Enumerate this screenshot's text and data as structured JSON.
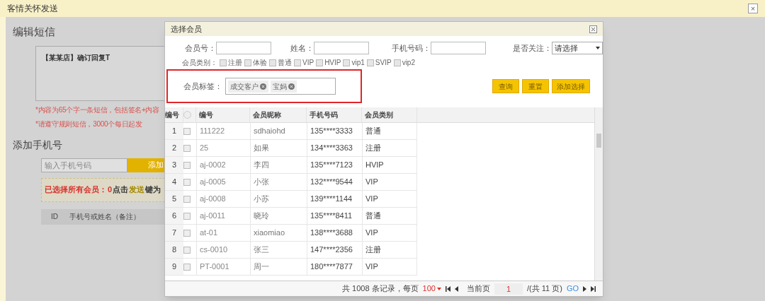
{
  "page": {
    "title": "客情关怀发送",
    "close": "×"
  },
  "editor": {
    "heading": "编辑短信",
    "message": "【某某店】确订回复T",
    "hints": [
      "*内容为65个字一条短信，包括签名+内容",
      "*请遵守规则短信，3000个每日起发"
    ]
  },
  "add_phone": {
    "heading": "添加手机号",
    "placeholder": "输入手机号码",
    "button": "添加",
    "notice_prefix": "已选择所有会员：",
    "count": "0",
    "notice_click": "点击",
    "notice_link": "发送",
    "notice_suffix": "键为"
  },
  "phone_table": {
    "columns": [
      "ID",
      "手机号或姓名（备注）"
    ]
  },
  "dialog": {
    "title": "选择会员",
    "filters": [
      {
        "kind": "input",
        "label": "会员号："
      },
      {
        "kind": "input",
        "label": "姓名："
      },
      {
        "kind": "input",
        "label": "手机号码："
      },
      {
        "kind": "select",
        "label": "是否关注：",
        "value": "请选择"
      }
    ],
    "category_label": "会员类别：",
    "categories": [
      {
        "label": "注册",
        "checked": false
      },
      {
        "label": "体验",
        "checked": false
      },
      {
        "label": "普通",
        "checked": false
      },
      {
        "label": "VIP",
        "checked": false
      },
      {
        "label": "HVIP",
        "checked": false
      },
      {
        "label": "vip1",
        "checked": false
      },
      {
        "label": "SVIP",
        "checked": false
      },
      {
        "label": "vip2",
        "checked": false
      }
    ],
    "tag_label": "会员标签：",
    "tags": [
      "成交客户",
      "宝妈"
    ],
    "buttons": [
      "查询",
      "重置",
      "添加选择"
    ],
    "table": {
      "select_all_checked": false,
      "columns": [
        "编号",
        "编号",
        "会员昵称",
        "手机号码",
        "会员类别"
      ],
      "rows": [
        {
          "index": "1",
          "checked": false,
          "code": "111222",
          "nickname": "sdhaiohd",
          "phone": "135****3333",
          "type": "普通"
        },
        {
          "index": "2",
          "checked": false,
          "code": "25",
          "nickname": "如果",
          "phone": "134****3363",
          "type": "注册"
        },
        {
          "index": "3",
          "checked": false,
          "code": "aj-0002",
          "nickname": "李四",
          "phone": "135****7123",
          "type": "HVIP"
        },
        {
          "index": "4",
          "checked": false,
          "code": "aj-0005",
          "nickname": "小张",
          "phone": "132****9544",
          "type": "VIP"
        },
        {
          "index": "5",
          "checked": false,
          "code": "aj-0008",
          "nickname": "小苏",
          "phone": "139****1144",
          "type": "VIP"
        },
        {
          "index": "6",
          "checked": false,
          "code": "aj-0011",
          "nickname": "晓玲",
          "phone": "135****8411",
          "type": "普通"
        },
        {
          "index": "7",
          "checked": false,
          "code": "at-01",
          "nickname": "xiaomiao",
          "phone": "138****3688",
          "type": "VIP"
        },
        {
          "index": "8",
          "checked": false,
          "code": "cs-0010",
          "nickname": "张三",
          "phone": "147****2356",
          "type": "注册"
        },
        {
          "index": "9",
          "checked": false,
          "code": "PT-0001",
          "nickname": "周一",
          "phone": "180****7877",
          "type": "VIP"
        }
      ]
    },
    "pager": {
      "total_prefix": "共 1008 条记录，每页",
      "page_size": "100",
      "current_label": "当前页",
      "current_page": "1",
      "total_pages": "/(共 11 页)",
      "go": "GO"
    }
  }
}
